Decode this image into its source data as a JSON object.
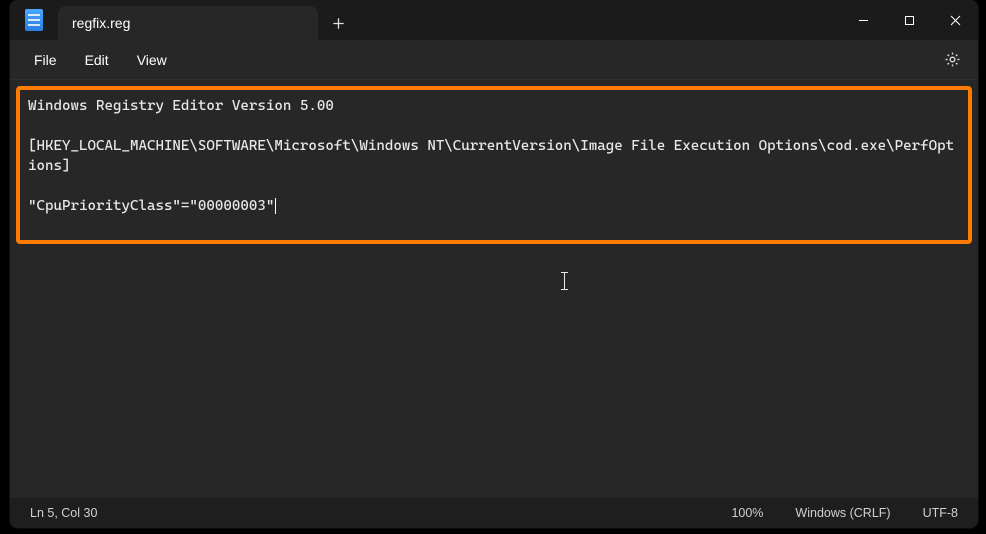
{
  "tab": {
    "title": "regfix.reg"
  },
  "menu": {
    "file": "File",
    "edit": "Edit",
    "view": "View"
  },
  "content": {
    "line1": "Windows Registry Editor Version 5.00",
    "line2": "",
    "line3": "[HKEY_LOCAL_MACHINE\\SOFTWARE\\Microsoft\\Windows NT\\CurrentVersion\\Image File Execution Options\\cod.exe\\PerfOptions]",
    "line4": "",
    "line5": "\"CpuPriorityClass\"=\"00000003\""
  },
  "status": {
    "position": "Ln 5, Col 30",
    "zoom": "100%",
    "line_ending": "Windows (CRLF)",
    "encoding": "UTF-8"
  }
}
